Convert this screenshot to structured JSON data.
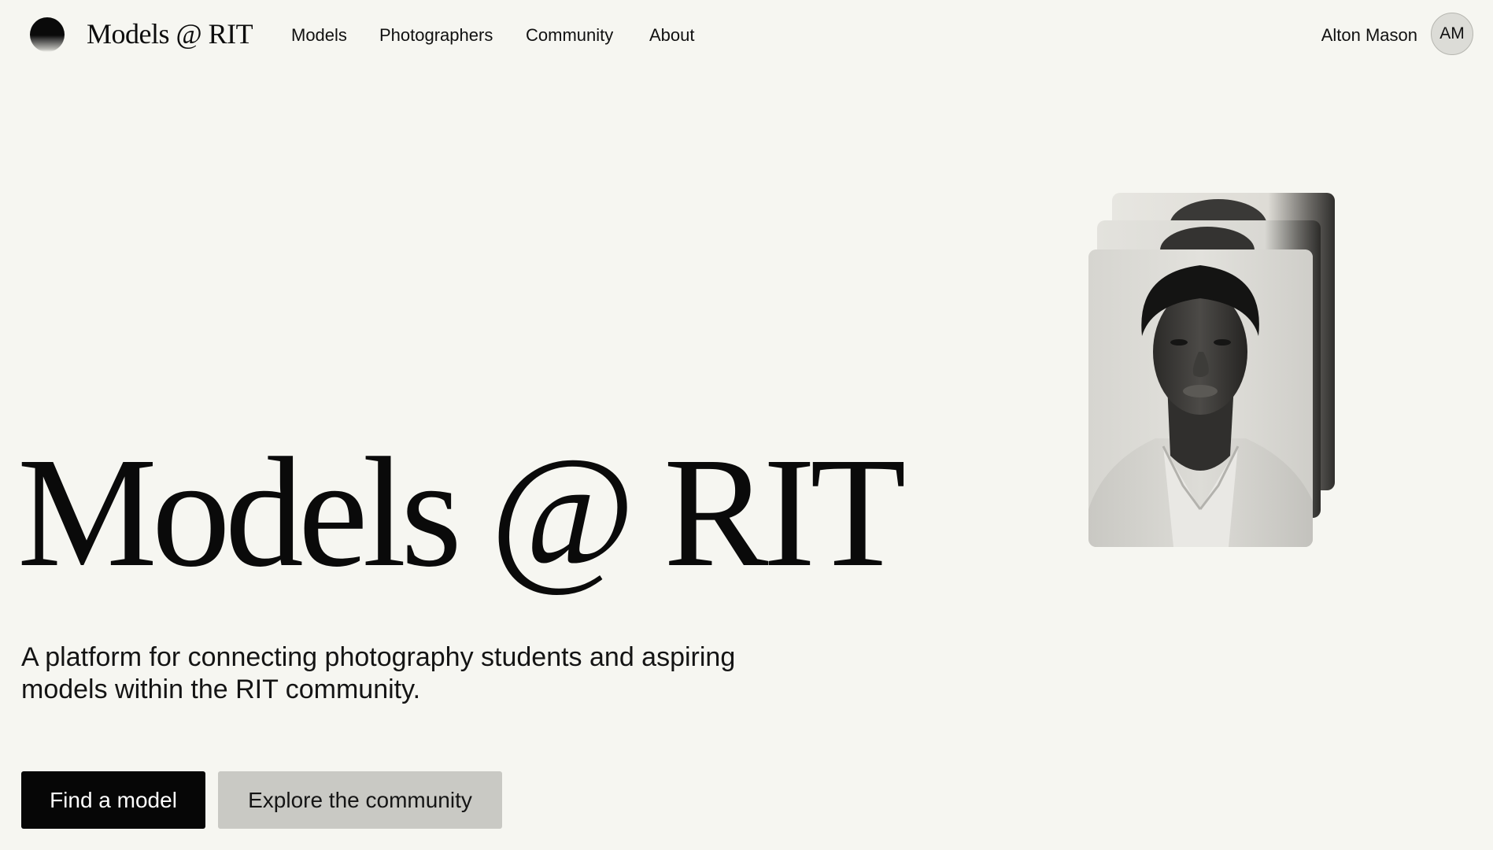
{
  "nav": {
    "brand": "Models @ RIT",
    "links": [
      "Models",
      "Photographers",
      "Community",
      "About"
    ],
    "user_name": "Alton Mason",
    "user_initials": "AM"
  },
  "hero": {
    "title": "Models @ RIT",
    "subtitle_line1": "A platform for connecting photography students and aspiring",
    "subtitle_line2": "models within the RIT community.",
    "primary_button": "Find a model",
    "secondary_button": "Explore the community"
  },
  "colors": {
    "background": "#f6f6f1",
    "text": "#0d0d0d",
    "primary_button_bg": "#060606",
    "secondary_button_bg": "#c9c9c4",
    "avatar_bg": "#dcdcd7"
  },
  "icons": {
    "logo": "half-filled-circle-icon"
  }
}
